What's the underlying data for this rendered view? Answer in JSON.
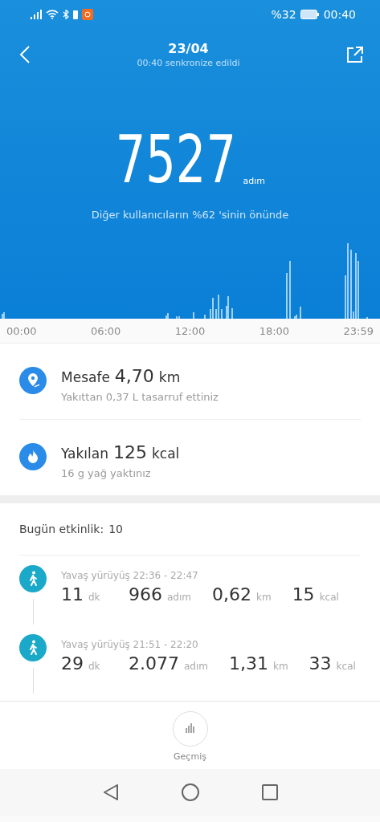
{
  "status_bar": {
    "battery": "%32",
    "time": "00:40"
  },
  "header": {
    "title": "23/04",
    "subtitle": "00:40 senkronize edildi"
  },
  "steps": {
    "value": "7527",
    "unit": "adım",
    "note": "Diğer kullanıcıların %62 'sinin önünde"
  },
  "axis_labels": [
    "00:00",
    "06:00",
    "12:00",
    "18:00",
    "23:59"
  ],
  "stats": [
    {
      "kind": "distance",
      "label": "Mesafe",
      "value": "4,70",
      "unit": "km",
      "note": "Yakıttan 0,37 L tasarruf ettiniz"
    },
    {
      "kind": "calories",
      "label": "Yakılan",
      "value": "125",
      "unit": "kcal",
      "note": "16 g yağ yaktınız"
    }
  ],
  "activity": {
    "label": "Bugün etkinlik:",
    "count": "10",
    "items": [
      {
        "title": "Yavaş yürüyüş 22:36 - 22:47",
        "metrics": [
          {
            "value": "11",
            "unit": "dk"
          },
          {
            "value": "966",
            "unit": "adım"
          },
          {
            "value": "0,62",
            "unit": "km"
          },
          {
            "value": "15",
            "unit": "kcal"
          }
        ]
      },
      {
        "title": "Yavaş yürüyüş 21:51 - 22:20",
        "metrics": [
          {
            "value": "29",
            "unit": "dk"
          },
          {
            "value": "2.077",
            "unit": "adım"
          },
          {
            "value": "1,31",
            "unit": "km"
          },
          {
            "value": "33",
            "unit": "kcal"
          }
        ]
      }
    ]
  },
  "history_button": {
    "label": "Geçmiş"
  }
}
